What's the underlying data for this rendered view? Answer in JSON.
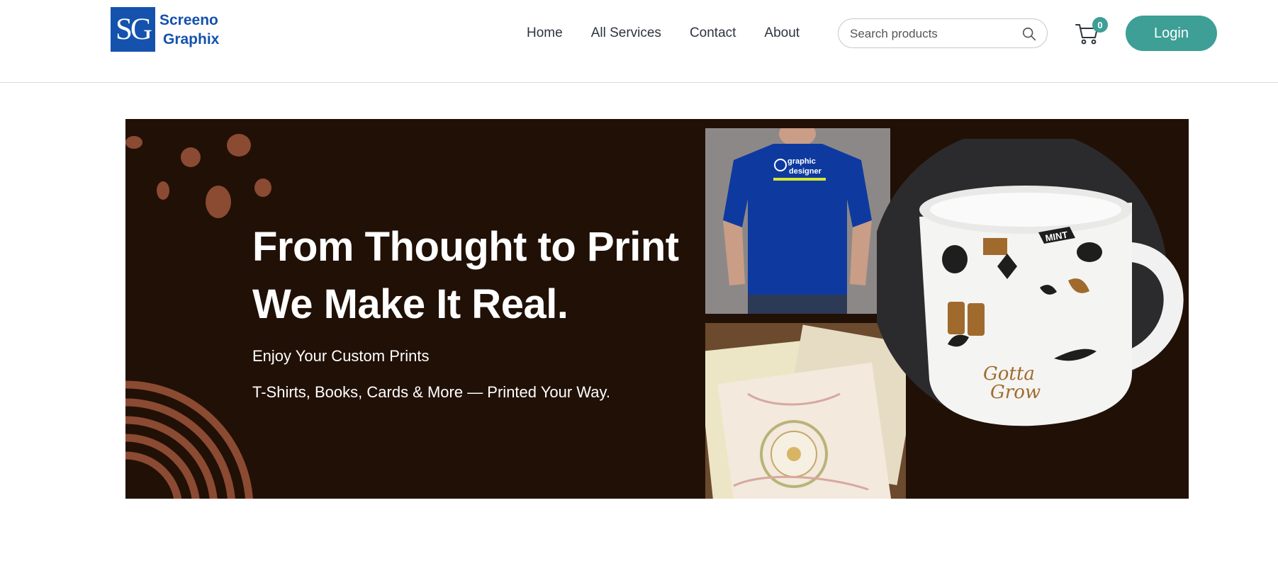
{
  "brand": {
    "logo_mark": "SG",
    "name_line1": "Screeno",
    "name_line2": "Graphix",
    "color": "#1452ad"
  },
  "nav": {
    "items": [
      {
        "label": "Home"
      },
      {
        "label": "All Services"
      },
      {
        "label": "Contact"
      },
      {
        "label": "About"
      }
    ]
  },
  "search": {
    "placeholder": "Search products",
    "icon": "search-icon"
  },
  "cart": {
    "icon": "cart-icon",
    "count": "0"
  },
  "login": {
    "label": "Login",
    "color": "#3d9f96"
  },
  "hero": {
    "title_line1": "From Thought to Print",
    "title_line2": "We Make It Real.",
    "subtitle": "Enjoy Your Custom Prints",
    "tagline": "T-Shirts, Books, Cards & More — Printed Your Way.",
    "background": "#211006",
    "accent": "#8b4a32",
    "shirt_print_line1": "graphic",
    "shirt_print_line2": "designer",
    "mug_label": "MINT"
  }
}
